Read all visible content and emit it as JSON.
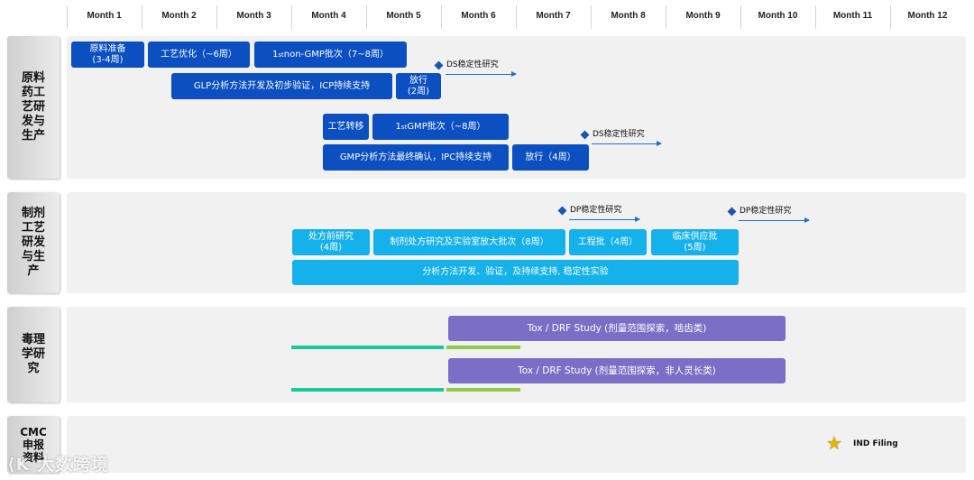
{
  "months": [
    "Month 1",
    "Month 2",
    "Month 3",
    "Month 4",
    "Month 5",
    "Month 6",
    "Month 7",
    "Month 8",
    "Month 9",
    "Month 10",
    "Month 11",
    "Month 12"
  ],
  "lanes": {
    "api": "原料药工艺研发与生产",
    "formulation": "制剂工艺研发与生产",
    "tox": "毒理学研究",
    "cmc": "CMC申报资料"
  },
  "api_tasks": {
    "raw_material_1": "原料准备",
    "raw_material_2": "(3-4周)",
    "process_opt": "工艺优化（~6周）",
    "non_gmp_pre": "1",
    "non_gmp_sup": "st",
    "non_gmp_post": " non-GMP批次（7~8周）",
    "glp_method": "GLP分析方法开发及初步验证，ICP持续支持",
    "release_1a": "放行",
    "release_1b": "(2周)",
    "tech_transfer": "工艺转移",
    "gmp_pre": "1",
    "gmp_sup": "st",
    "gmp_post": " GMP批次（~8周）",
    "gmp_method": "GMP分析方法最终确认，IPC持续支持",
    "release_2": "放行（4周）",
    "ds_stability_1": "DS稳定性研究",
    "ds_stability_2": "DS稳定性研究"
  },
  "formulation_tasks": {
    "pre_form_1": "处方前研究",
    "pre_form_2": "(4周)",
    "form_research": "制剂处方研究及实验室放大批次（8周）",
    "eng_batch": "工程批（4周）",
    "clinical_1": "临床供应批",
    "clinical_2": "(5周)",
    "analytical": "分析方法开发、验证，及持续支持, 稳定性实验",
    "dp_stability_1": "DP稳定性研究",
    "dp_stability_2": "DP稳定性研究"
  },
  "tox_tasks": {
    "study_1": "Tox / DRF Study (剂量范围探索，啮齿类)",
    "study_2": "Tox / DRF Study (剂量范围探索，非人灵长类)"
  },
  "cmc": {
    "ind_filing": "IND Filing"
  },
  "watermark": "大数跨境",
  "colors": {
    "dark_blue": "#0b4fc0",
    "light_blue": "#14b1ea",
    "purple": "#7b6ec6",
    "teal": "#1cc89a",
    "green": "#8fca4c",
    "star": "#e9b200"
  }
}
